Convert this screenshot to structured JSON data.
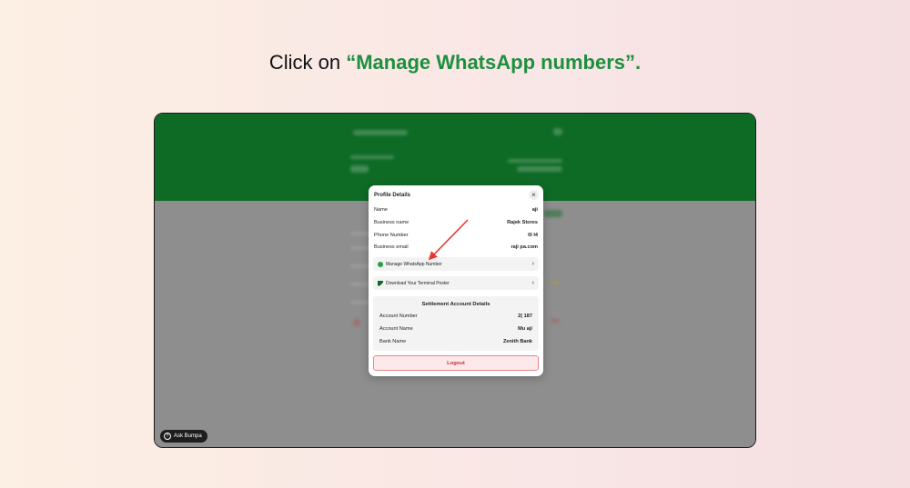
{
  "instruction": {
    "prefix": "Click on ",
    "highlight": "“Manage WhatsApp numbers”."
  },
  "floating": {
    "ask_label": "Ask Bumpa",
    "ask_icon": "question-circle-icon"
  },
  "modal": {
    "title": "Profile Details",
    "close_icon": "close-icon",
    "fields": [
      {
        "label": "Name",
        "value": "aji"
      },
      {
        "label": "Business name",
        "value": "Rajek Stores"
      },
      {
        "label": "Phone Number",
        "value": "0I          I4"
      },
      {
        "label": "Business email",
        "value": "raji          pa.com"
      }
    ],
    "manage_whatsapp": "Manage WhatsApp Number",
    "download_poster": "Download Your Terminal Poster",
    "settlement": {
      "title": "Settlement Account Details",
      "rows": [
        {
          "label": "Account Number",
          "value": "2(          187"
        },
        {
          "label": "Account Name",
          "value": "Mu          aji"
        },
        {
          "label": "Bank Name",
          "value": "Zenith Bank"
        }
      ]
    },
    "logout": "Logout"
  },
  "colors": {
    "accent_green": "#1e8f3e",
    "header_green": "#0e6b26",
    "logout_red": "#c0313f",
    "arrow_red": "#e8392f"
  }
}
